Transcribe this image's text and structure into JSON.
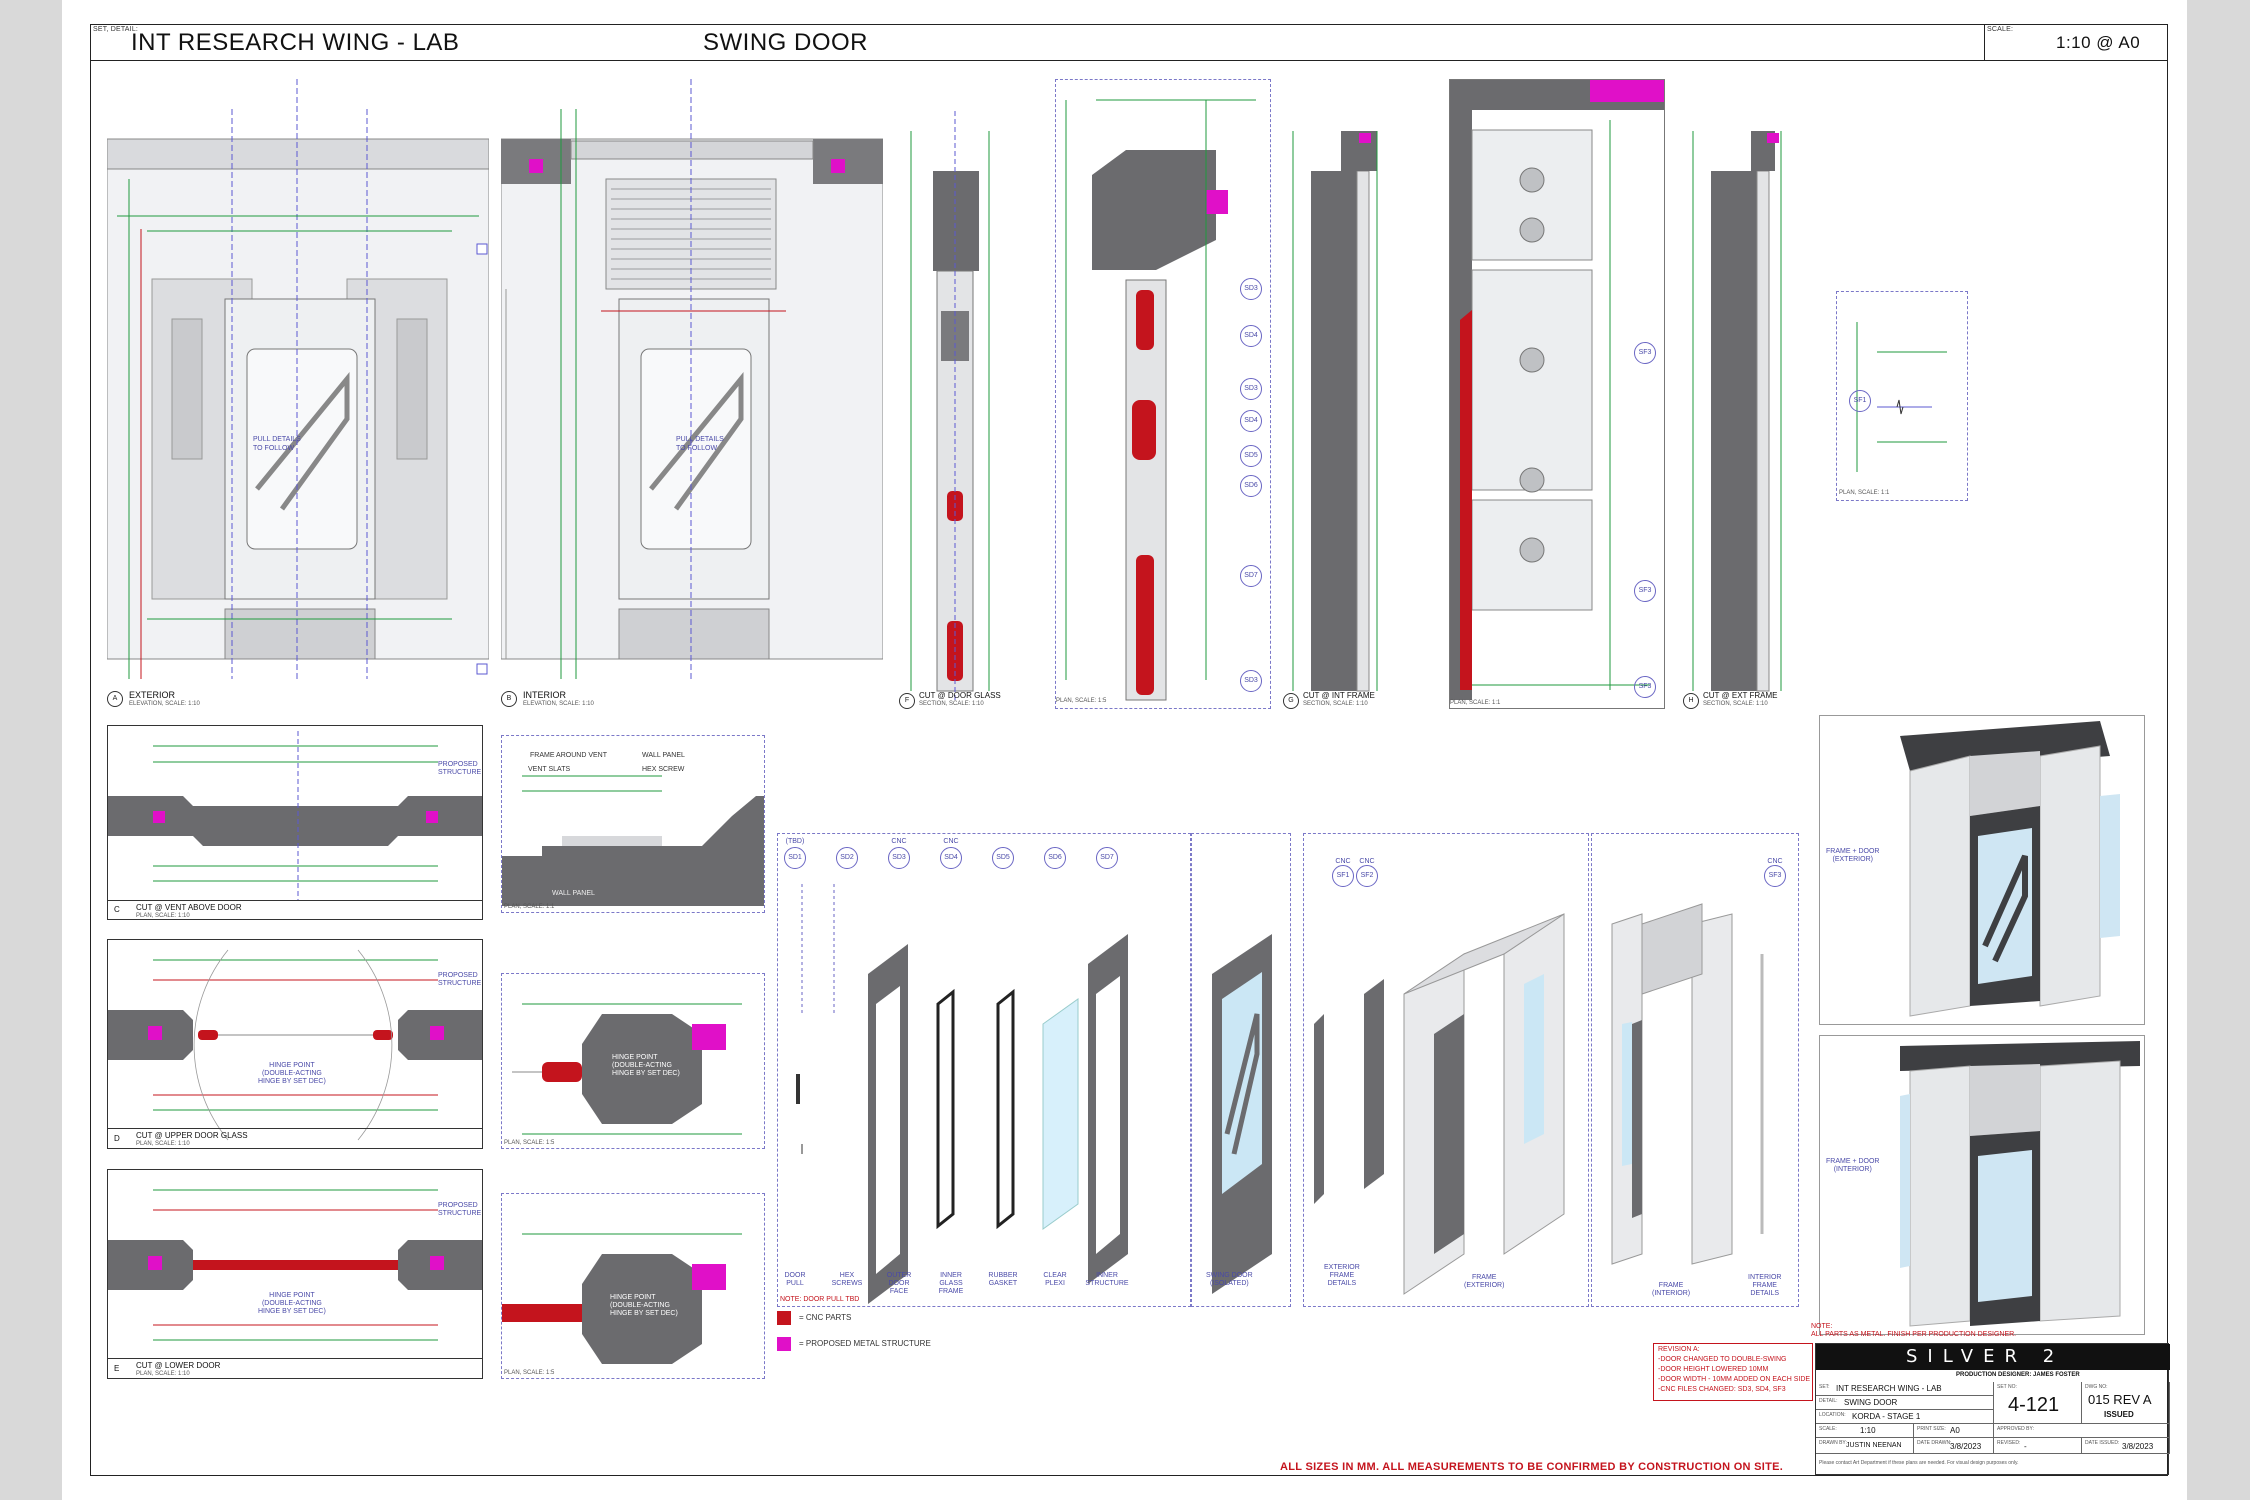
{
  "header": {
    "set_detail_caption": "SET, DETAIL:",
    "set_name": "INT RESEARCH WING - LAB",
    "detail_name": "SWING DOOR",
    "scale_caption": "SCALE:",
    "scale_value": "1:10  @ A0"
  },
  "elevations": [
    {
      "badge": "A",
      "title": "EXTERIOR",
      "subtitle": "ELEVATION, SCALE: 1:10"
    },
    {
      "badge": "B",
      "title": "INTERIOR",
      "subtitle": "ELEVATION, SCALE: 1:10"
    },
    {
      "badge": "F",
      "title": "CUT @ DOOR GLASS",
      "subtitle": "SECTION, SCALE: 1:10"
    },
    {
      "badge": "",
      "title": "",
      "subtitle": "PLAN, SCALE: 1:5"
    },
    {
      "badge": "G",
      "title": "CUT @ INT FRAME",
      "subtitle": "SECTION, SCALE: 1:10"
    },
    {
      "badge": "",
      "title": "",
      "subtitle": "PLAN, SCALE: 1:1"
    },
    {
      "badge": "H",
      "title": "CUT @ EXT FRAME",
      "subtitle": "SECTION, SCALE: 1:10"
    }
  ],
  "pull_details": "PULL DETAILS\nTO FOLLOW",
  "plan_small_caption": "PLAN, SCALE: 1:1",
  "cuts": [
    {
      "badge": "C",
      "title": "CUT @ VENT ABOVE DOOR",
      "subtitle": "PLAN, SCALE: 1:10",
      "proposed": "PROPOSED\nSTRUCTURE"
    },
    {
      "badge": "D",
      "title": "CUT @ UPPER DOOR GLASS",
      "subtitle": "PLAN, SCALE: 1:10",
      "proposed": "PROPOSED\nSTRUCTURE"
    },
    {
      "badge": "E",
      "title": "CUT @ LOWER DOOR",
      "subtitle": "PLAN, SCALE: 1:10",
      "proposed": "PROPOSED\nSTRUCTURE"
    }
  ],
  "vent_detail": {
    "labels": [
      "FRAME AROUND VENT",
      "VENT SLATS",
      "WALL PANEL",
      "HEX SCREW",
      "WALL PANEL"
    ],
    "caption": "PLAN, SCALE: 1:1"
  },
  "hinge_text": "HINGE POINT\n(DOUBLE-ACTING\nHINGE BY SET DEC)",
  "detail_caption": "PLAN, SCALE: 1:5",
  "exploded": {
    "parts": [
      {
        "top": "(TBD)",
        "code": "SD1",
        "label": "DOOR\nPULL"
      },
      {
        "top": "",
        "code": "SD2",
        "label": "HEX\nSCREWS"
      },
      {
        "top": "CNC",
        "code": "SD3",
        "label": "OUTER\nDOOR\nFACE"
      },
      {
        "top": "CNC",
        "code": "SD4",
        "label": "INNER\nGLASS\nFRAME"
      },
      {
        "top": "",
        "code": "SD5",
        "label": "RUBBER\nGASKET"
      },
      {
        "top": "",
        "code": "SD6",
        "label": "CLEAR\nPLEXI"
      },
      {
        "top": "",
        "code": "SD7",
        "label": "INNER\nSTRUCTURE"
      }
    ],
    "swing_door_label": "SWING DOOR\n(ISOLATED)",
    "door_pull_note": "NOTE: DOOR PULL TBD",
    "frame_parts": [
      {
        "top": "CNC",
        "code": "SF1"
      },
      {
        "top": "CNC",
        "code": "SF2"
      }
    ],
    "ext_frame_details": "EXTERIOR\nFRAME\nDETAILS",
    "frame_exterior": "FRAME\n(EXTERIOR)",
    "frame_interior": "FRAME\n(INTERIOR)",
    "int_frame_details": "INTERIOR\nFRAME\nDETAILS",
    "sf3": {
      "top": "CNC",
      "code": "SF3"
    }
  },
  "renders": [
    {
      "label": "FRAME + DOOR\n(EXTERIOR)"
    },
    {
      "label": "FRAME + DOOR\n(INTERIOR)"
    }
  ],
  "legend": [
    {
      "text": "= CNC PARTS",
      "color": "#c4141d"
    },
    {
      "text": "= PROPOSED METAL STRUCTURE",
      "color": "#e010c8"
    }
  ],
  "notes": {
    "note_title": "NOTE:",
    "note_text": "ALL PARTS AS METAL. FINISH PER PRODUCTION DESIGNER.",
    "revision_title": "REVISION A:",
    "revision_lines": [
      "-DOOR CHANGED TO DOUBLE-SWING",
      "-DOOR HEIGHT LOWERED 10MM",
      "-DOOR WIDTH - 10MM ADDED ON EACH SIDE",
      "-CNC FILES CHANGED: SD3, SD4, SF3"
    ],
    "footer": "ALL SIZES IN MM. ALL MEASUREMENTS TO BE CONFIRMED BY CONSTRUCTION ON SITE."
  },
  "title_block": {
    "logo": "SILVER 2",
    "production_designer": "PRODUCTION DESIGNER: JAMES FOSTER",
    "set_caption": "SET:",
    "set_value": "INT RESEARCH WING - LAB",
    "detail_caption": "DETAIL:",
    "detail_value": "SWING DOOR",
    "location_caption": "LOCATION:",
    "location_value": "KORDA - STAGE 1",
    "scale_caption": "SCALE:",
    "scale_value": "1:10",
    "print_caption": "PRINT SIZE:",
    "print_value": "A0",
    "drawn_caption": "DRAWN BY:",
    "drawn_value": "JUSTIN NEENAN",
    "date_drawn_caption": "DATE DRAWN:",
    "date_drawn_value": "3/8/2023",
    "revised_caption": "REVISED:",
    "revised_value": "-",
    "set_no_caption": "SET NO:",
    "set_no_value": "4-121",
    "dwg_caption": "DWG NO:",
    "dwg_value": "015 REV A",
    "approved_caption": "APPROVED BY:",
    "status": "ISSUED",
    "date_issued_caption": "DATE ISSUED:",
    "date_issued_value": "3/8/2023",
    "disclaimer": "Please contact Art Department if these plans are needed. For visual design purposes only."
  },
  "colors": {
    "cnc": "#c4141d",
    "structure": "#e010c8",
    "metal_dark": "#6b6b6e",
    "metal_light": "#e9eaec",
    "dim_green": "#1f9a3e",
    "guide_purple": "#6a66c4"
  }
}
